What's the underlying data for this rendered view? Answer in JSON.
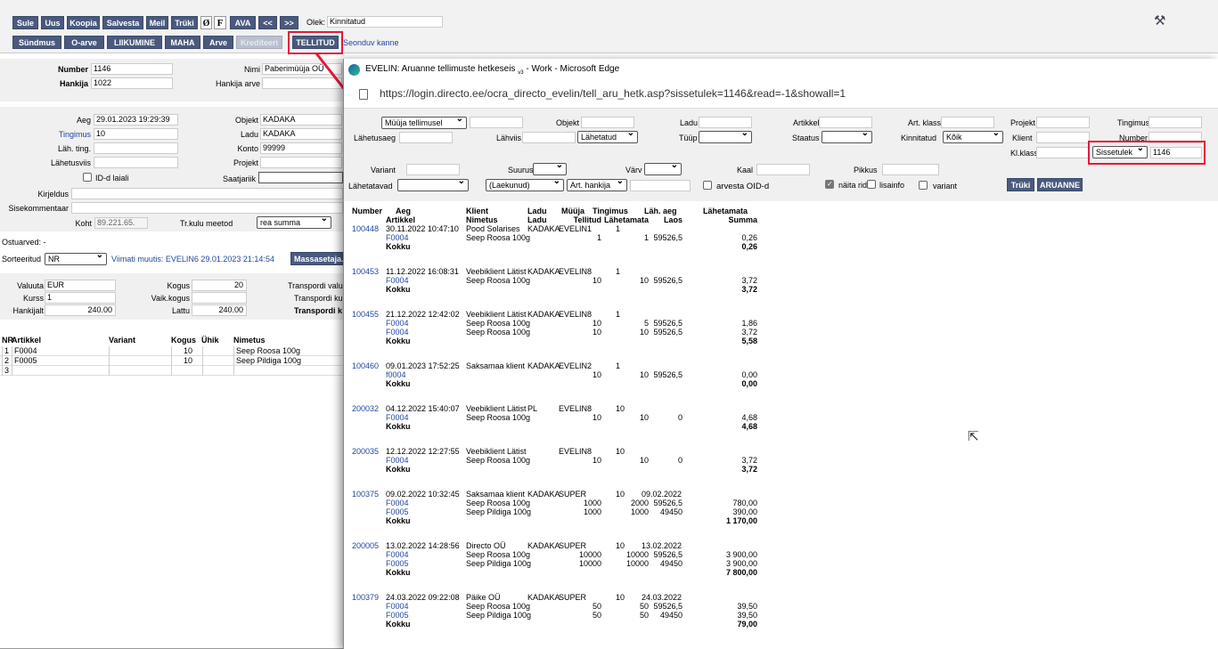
{
  "toolbar1": [
    "Sule",
    "Uus",
    "Koopia",
    "Salvesta",
    "Meil",
    "Trüki",
    "AVA",
    "<<",
    ">>"
  ],
  "toolbar1_icons": [
    "Ø",
    "F"
  ],
  "olek_label": "Olek:",
  "olek_value": "Kinnitatud",
  "toolbar2": [
    "Sündmus",
    "O-arve",
    "LIIKUMINE",
    "MAHA",
    "Arve",
    "Krediteeri",
    "TELLITUD"
  ],
  "seonduv": "Seonduv kanne",
  "form": {
    "number_label": "Number",
    "number": "1146",
    "hankija_label": "Hankija",
    "hankija": "1022",
    "nimi_label": "Nimi",
    "nimi": "Paberimüüja OÜ",
    "hankija_arve_label": "Hankija arve",
    "aeg_label": "Aeg",
    "aeg": "29.01.2023 19:29:39",
    "tingimus_label": "Tingimus",
    "tingimus": "10",
    "lah_ting_label": "Läh. ting.",
    "lahetusviis_label": "Lähetusviis",
    "id_laiali": "ID-d laiali",
    "kirjeldus_label": "Kirjeldus",
    "sisekom_label": "Sisekommentaar",
    "objekt_label": "Objekt",
    "objekt": "KADAKA",
    "ladu_label": "Ladu",
    "ladu": "KADAKA",
    "konto_label": "Konto",
    "konto": "99999",
    "projekt_label": "Projekt",
    "saatjariik_label": "Saatjariik",
    "koht_label": "Koht",
    "koht": "89.221.65.",
    "trkulu_label": "Tr.kulu meetod",
    "trkulu": "rea summa",
    "ostuarved": "Ostuarved: -",
    "sorteeritud_label": "Sorteeritud",
    "sorteeritud": "NR",
    "viimati": "Viimati muutis: EVELIN6 29.01.2023 21:14:54",
    "massasetaja": "Massasetaja...",
    "valuuta_label": "Valuuta",
    "valuuta": "EUR",
    "kurss_label": "Kurss",
    "kurss": "1",
    "hankijalt_label": "Hankijalt",
    "hankijalt": "240.00",
    "kogus_label": "Kogus",
    "kogus": "20",
    "vaik_label": "Vaik.kogus",
    "lattu_label": "Lattu",
    "lattu": "240.00",
    "transp1": "Transpordi valu",
    "transp2": "Transpordi ku",
    "transp3": "Transpordi k"
  },
  "rows_head": [
    "NR",
    "Artikkel",
    "Variant",
    "Kogus",
    "Ühik",
    "Nimetus"
  ],
  "rows": [
    {
      "nr": "1",
      "art": "F0004",
      "kogus": "10",
      "nim": "Seep Roosa 100g"
    },
    {
      "nr": "2",
      "art": "F0005",
      "kogus": "10",
      "nim": "Seep Pildiga 100g"
    },
    {
      "nr": "3",
      "art": "",
      "kogus": "",
      "nim": ""
    }
  ],
  "popup": {
    "title": "EVELIN: Aruanne tellimuste hetkeseis",
    "title_sup": "v3",
    "title_rest": " - Work - Microsoft Edge",
    "url": "https://login.directo.ee/ocra_directo_evelin/tell_aru_hetk.asp?sissetulek=1146&read=-1&showall=1",
    "f": {
      "muuja": "Müüja tellimusel",
      "objekt": "Objekt",
      "ladu": "Ladu",
      "artikkel": "Artikkel",
      "artklass": "Art. klass",
      "projekt": "Projekt",
      "tingimus": "Tingimus",
      "lahetusaeg": "Lähetusaeg",
      "lahviis": "Lähviis",
      "lahetatud": "Lähetatud",
      "tyyp": "Tüüp",
      "staatus": "Staatus",
      "kinnitatud": "Kinnitatud",
      "koik": "Kõik",
      "klient": "Klient",
      "number": "Number",
      "klklass": "Kl.klass",
      "sissetulek": "Sissetulek",
      "sissetulek_val": "1146",
      "variant": "Variant",
      "suurus": "Suurus",
      "varv": "Värv",
      "kaal": "Kaal",
      "pikkus": "Pikkus",
      "lahetatavad": "Lähetatavad",
      "laekunud": "(Laekunud)",
      "arthankija": "Art. hankija",
      "arvesta": "arvesta OID-d",
      "naita": "näita ridu",
      "lisainfo": "lisainfo",
      "variant2": "variant",
      "truki": "Trüki",
      "aruanne": "ARUANNE"
    },
    "head1": [
      "Number",
      "Aeg",
      "Klient",
      "Ladu",
      "Müüja",
      "Tingimus",
      "Läh. aeg",
      "Lähetamata"
    ],
    "head2": [
      "Artikkel",
      "Nimetus",
      "Ladu",
      "Tellitud",
      "Lähetamata",
      "Laos",
      "Summa"
    ],
    "kokku": "Kokku",
    "orders": [
      {
        "no": "100448",
        "aeg": "30.11.2022 10:47:10",
        "klient": "Pood Solarises",
        "ladu": "KADAKA",
        "muuja": "EVELIN1",
        "ting": "1",
        "lah": "",
        "lines": [
          {
            "a": "F0004",
            "n": "Seep Roosa 100g",
            "t": "1",
            "l": "1",
            "laos": "59526,5",
            "s": "0,26"
          }
        ],
        "total": "0,26"
      },
      {
        "no": "100453",
        "aeg": "11.12.2022 16:08:31",
        "klient": "Veebiklient Lätist",
        "ladu": "KADAKA",
        "muuja": "EVELIN8",
        "ting": "1",
        "lah": "",
        "lines": [
          {
            "a": "F0004",
            "n": "Seep Roosa 100g",
            "t": "10",
            "l": "10",
            "laos": "59526,5",
            "s": "3,72"
          }
        ],
        "total": "3,72"
      },
      {
        "no": "100455",
        "aeg": "21.12.2022 12:42:02",
        "klient": "Veebiklient Lätist",
        "ladu": "KADAKA",
        "muuja": "EVELIN8",
        "ting": "1",
        "lah": "",
        "lines": [
          {
            "a": "F0004",
            "n": "Seep Roosa 100g",
            "t": "10",
            "l": "5",
            "laos": "59526,5",
            "s": "1,86"
          },
          {
            "a": "F0004",
            "n": "Seep Roosa 100g",
            "t": "10",
            "l": "10",
            "laos": "59526,5",
            "s": "3,72"
          }
        ],
        "total": "5,58"
      },
      {
        "no": "100460",
        "aeg": "09.01.2023 17:52:25",
        "klient": "Saksamaa klient",
        "ladu": "KADAKA",
        "muuja": "EVELIN2",
        "ting": "1",
        "lah": "",
        "lines": [
          {
            "a": "f0004",
            "n": "",
            "t": "10",
            "l": "10",
            "laos": "59526,5",
            "s": "0,00"
          }
        ],
        "total": "0,00"
      },
      {
        "no": "200032",
        "aeg": "04.12.2022 15:40:07",
        "klient": "Veebiklient Lätist",
        "ladu": "PL",
        "muuja": "EVELIN8",
        "ting": "10",
        "lah": "",
        "lines": [
          {
            "a": "F0004",
            "n": "Seep Roosa 100g",
            "t": "10",
            "l": "10",
            "laos": "0",
            "s": "4,68"
          }
        ],
        "total": "4,68"
      },
      {
        "no": "200035",
        "aeg": "12.12.2022 12:27:55",
        "klient": "Veebiklient Lätist",
        "ladu": "",
        "muuja": "EVELIN8",
        "ting": "10",
        "lah": "",
        "lines": [
          {
            "a": "F0004",
            "n": "Seep Roosa 100g",
            "t": "10",
            "l": "10",
            "laos": "0",
            "s": "3,72"
          }
        ],
        "total": "3,72"
      },
      {
        "no": "100375",
        "aeg": "09.02.2022 10:32:45",
        "klient": "Saksamaa klient",
        "ladu": "KADAKA",
        "muuja": "SUPER",
        "ting": "10",
        "lah": "09.02.2022",
        "lines": [
          {
            "a": "F0004",
            "n": "Seep Roosa 100g",
            "t": "1000",
            "l": "2000",
            "laos": "59526,5",
            "s": "780,00"
          },
          {
            "a": "F0005",
            "n": "Seep Pildiga 100g",
            "t": "1000",
            "l": "1000",
            "laos": "49450",
            "s": "390,00"
          }
        ],
        "total": "1 170,00"
      },
      {
        "no": "200005",
        "aeg": "13.02.2022 14:28:56",
        "klient": "Directo OÜ",
        "ladu": "KADAKA",
        "muuja": "SUPER",
        "ting": "10",
        "lah": "13.02.2022",
        "lines": [
          {
            "a": "F0004",
            "n": "Seep Roosa 100g",
            "t": "10000",
            "l": "10000",
            "laos": "59526,5",
            "s": "3 900,00"
          },
          {
            "a": "F0005",
            "n": "Seep Pildiga 100g",
            "t": "10000",
            "l": "10000",
            "laos": "49450",
            "s": "3 900,00"
          }
        ],
        "total": "7 800,00"
      },
      {
        "no": "100379",
        "aeg": "24.03.2022 09:22:08",
        "klient": "Päike OÜ",
        "ladu": "KADAKA",
        "muuja": "SUPER",
        "ting": "10",
        "lah": "24.03.2022",
        "lines": [
          {
            "a": "F0004",
            "n": "Seep Roosa 100g",
            "t": "50",
            "l": "50",
            "laos": "59526,5",
            "s": "39,50"
          },
          {
            "a": "F0005",
            "n": "Seep Pildiga 100g",
            "t": "50",
            "l": "50",
            "laos": "49450",
            "s": "39,50"
          }
        ],
        "total": "79,00"
      }
    ]
  },
  "colors": {
    "button": "#4a5a7e",
    "highlight": "#e8173a",
    "link": "#2346a0",
    "filter_bg": "#f0f0f0"
  }
}
